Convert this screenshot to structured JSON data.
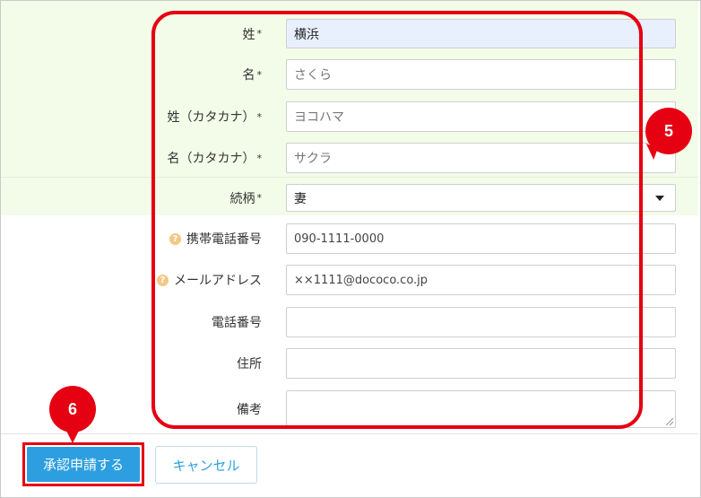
{
  "form": {
    "last_name": {
      "label": "姓",
      "required_mark": "*",
      "value": "横浜"
    },
    "first_name": {
      "label": "名",
      "required_mark": "*",
      "placeholder": "さくら"
    },
    "last_name_kana": {
      "label": "姓（カタカナ）",
      "required_mark": "*",
      "placeholder": "ヨコハマ"
    },
    "first_name_kana": {
      "label": "名（カタカナ）",
      "required_mark": "*",
      "placeholder": "サクラ"
    },
    "relationship": {
      "label": "続柄",
      "required_mark": "*",
      "value": "妻"
    },
    "mobile": {
      "label": "携帯電話番号",
      "help_glyph": "?",
      "placeholder": "090-1111-0000"
    },
    "email": {
      "label": "メールアドレス",
      "help_glyph": "?",
      "placeholder": "××1111@dococo.co.jp"
    },
    "phone": {
      "label": "電話番号",
      "value": ""
    },
    "address": {
      "label": "住所",
      "value": ""
    },
    "notes": {
      "label": "備考",
      "value": ""
    }
  },
  "callouts": {
    "step5": "5",
    "step6": "6"
  },
  "footer": {
    "approve_label": "承認申請する",
    "cancel_label": "キャンセル"
  },
  "colors": {
    "accent": "#2d9fe0",
    "highlight_red": "#e50012",
    "band_green": "#f3fbe9"
  }
}
